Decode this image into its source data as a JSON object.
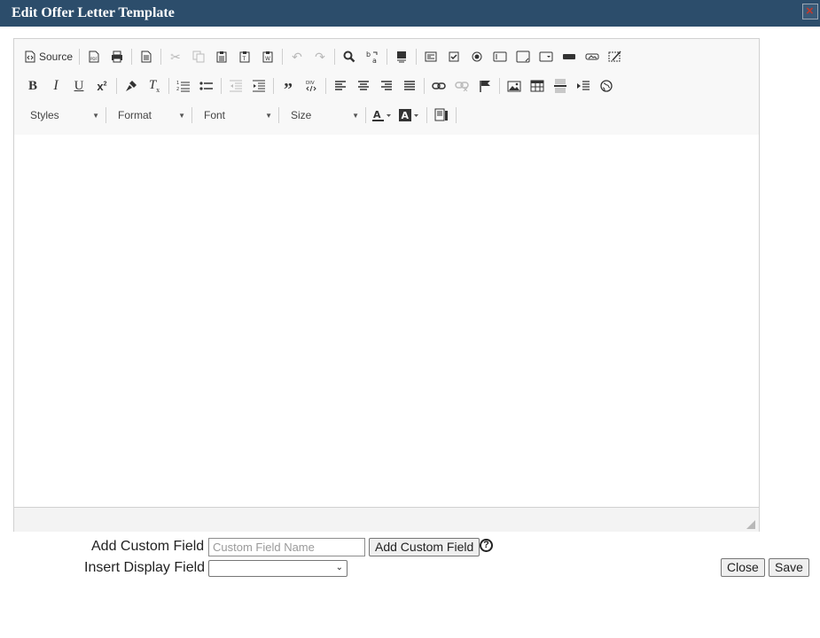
{
  "dialog": {
    "title": "Edit Offer Letter Template",
    "close_icon": "close-icon"
  },
  "toolbar": {
    "source_label": "Source",
    "styles_label": "Styles",
    "format_label": "Format",
    "font_label": "Font",
    "size_label": "Size"
  },
  "form": {
    "add_custom_field_label": "Add Custom Field",
    "custom_field_placeholder": "Custom Field Name",
    "add_custom_field_button": "Add Custom Field",
    "insert_display_field_label": "Insert Display Field",
    "help_glyph": "?",
    "close_button": "Close",
    "save_button": "Save"
  },
  "colors": {
    "titlebar": "#2c4d6b",
    "editor_border": "#d1d1d1",
    "toolbar_bg": "#f8f8f8"
  }
}
